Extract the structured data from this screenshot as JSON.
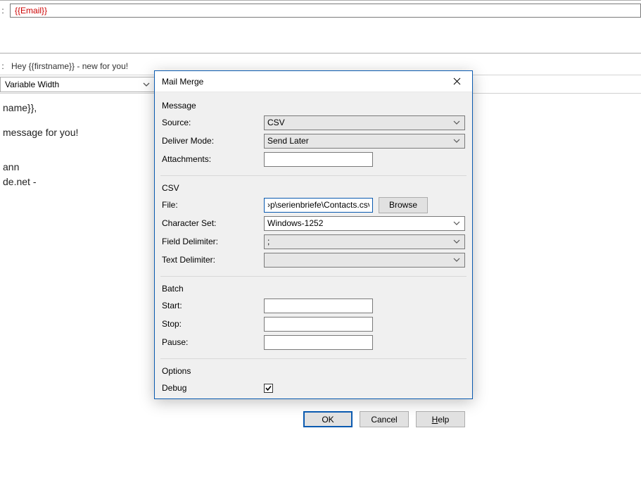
{
  "header": {
    "to_placeholder": "{{Email}}",
    "subject_label_suffix": ":",
    "subject_text": "Hey {{firstname}} - new for you!"
  },
  "toolbar": {
    "font_select": "Variable Width"
  },
  "body": {
    "line1": "name}},",
    "line2": "message for you!",
    "line3": "ann",
    "line4": "de.net -"
  },
  "dialog": {
    "title": "Mail Merge",
    "groups": {
      "message": {
        "title": "Message",
        "source_label": "Source:",
        "source_value": "CSV",
        "deliver_label": "Deliver Mode:",
        "deliver_value": "Send Later",
        "attachments_label": "Attachments:",
        "attachments_value": ""
      },
      "csv": {
        "title": "CSV",
        "file_label": "File:",
        "file_value": "›p\\serienbriefe\\Contacts.csv",
        "browse_label": "Browse",
        "charset_label": "Character Set:",
        "charset_value": "Windows-1252",
        "fielddelim_label": "Field Delimiter:",
        "fielddelim_value": ";",
        "textdelim_label": "Text Delimiter:",
        "textdelim_value": ""
      },
      "batch": {
        "title": "Batch",
        "start_label": "Start:",
        "start_value": "",
        "stop_label": "Stop:",
        "stop_value": "",
        "pause_label": "Pause:",
        "pause_value": ""
      },
      "options": {
        "title": "Options",
        "debug_label": "Debug",
        "debug_checked": true
      }
    },
    "buttons": {
      "ok": "OK",
      "cancel": "Cancel",
      "help_prefix": "H",
      "help_rest": "elp"
    }
  }
}
